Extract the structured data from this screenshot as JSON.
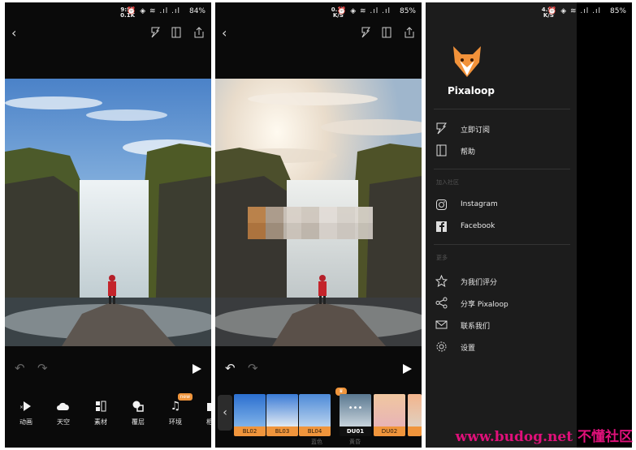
{
  "screens": [
    {
      "status": {
        "time_top": "9:57",
        "time_bottom": "0.1K",
        "icons": "⏰ ◈ ≋ .ıl .ıl",
        "battery": "84%"
      },
      "tools": [
        {
          "label": "动画",
          "icon": "animate-icon"
        },
        {
          "label": "天空",
          "icon": "sky-icon"
        },
        {
          "label": "素材",
          "icon": "elements-icon"
        },
        {
          "label": "覆层",
          "icon": "overlay-icon"
        },
        {
          "label": "环境",
          "icon": "ambience-icon",
          "badge": "new"
        },
        {
          "label": "相机",
          "icon": "camera-icon"
        }
      ]
    },
    {
      "status": {
        "time_top": "0.13",
        "time_bottom": "K/S",
        "icons": "⏰ ◈ ≋ .ıl .ıl",
        "battery": "85%"
      },
      "filters": [
        {
          "label": "BL02"
        },
        {
          "label": "BL03"
        },
        {
          "label": "BL04"
        },
        {
          "label": "DU01"
        },
        {
          "label": "DU02"
        }
      ],
      "filter_groups": [
        "蓝色",
        "黄昏"
      ]
    },
    {
      "status": {
        "time_top": "4.97",
        "time_bottom": "K/S",
        "icons": "⏰ ◈ ≋ .ıl .ıl",
        "battery": "85%"
      },
      "app_name": "Pixaloop",
      "menu_top": [
        {
          "label": "立即订阅",
          "icon": "subscribe-icon"
        },
        {
          "label": "帮助",
          "icon": "help-icon"
        }
      ],
      "section_community": "加入社区",
      "menu_community": [
        {
          "label": "Instagram",
          "icon": "instagram-icon"
        },
        {
          "label": "Facebook",
          "icon": "facebook-icon"
        }
      ],
      "section_more": "更多",
      "menu_more": [
        {
          "label": "为我们评分",
          "icon": "star-icon"
        },
        {
          "label": "分享 Pixaloop",
          "icon": "share-icon"
        },
        {
          "label": "联系我们",
          "icon": "mail-icon"
        },
        {
          "label": "设置",
          "icon": "gear-icon"
        }
      ]
    }
  ],
  "watermark": "www.budog.net 不懂社区",
  "colors": {
    "accent": "#f0953c",
    "watermark": "#e0107a",
    "drawer_bg": "#1c1c1c"
  }
}
